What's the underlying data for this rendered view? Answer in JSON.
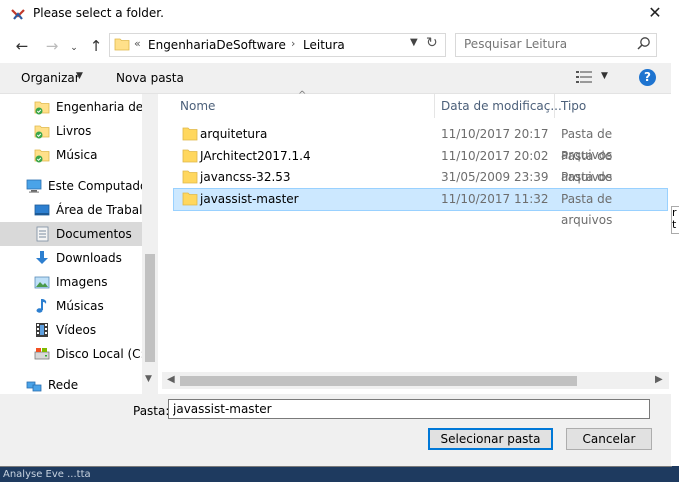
{
  "window": {
    "title": "Please select a folder."
  },
  "address": {
    "prefix": "«",
    "crumbs": [
      "EngenhariaDeSoftware",
      "Leitura"
    ],
    "separator": "›"
  },
  "search": {
    "placeholder": "Pesquisar Leitura"
  },
  "toolbar": {
    "organize_label": "Organizar",
    "new_folder_label": "Nova pasta"
  },
  "nav": {
    "items": [
      {
        "label": "Engenharia de Software",
        "icon": "folder-synced-icon"
      },
      {
        "label": "Livros",
        "icon": "folder-synced-icon"
      },
      {
        "label": "Música",
        "icon": "folder-synced-icon"
      },
      {
        "label": "Este Computador",
        "icon": "computer-icon"
      },
      {
        "label": "Área de Trabalho",
        "icon": "desktop-icon"
      },
      {
        "label": "Documentos",
        "icon": "documents-icon"
      },
      {
        "label": "Downloads",
        "icon": "downloads-icon"
      },
      {
        "label": "Imagens",
        "icon": "pictures-icon"
      },
      {
        "label": "Músicas",
        "icon": "music-icon"
      },
      {
        "label": "Vídeos",
        "icon": "videos-icon"
      },
      {
        "label": "Disco Local (C:)",
        "icon": "drive-icon"
      },
      {
        "label": "Rede",
        "icon": "network-icon"
      }
    ],
    "selected": "Documentos"
  },
  "columns": {
    "name": "Nome",
    "date": "Data de modificaç...",
    "type": "Tipo"
  },
  "files": [
    {
      "name": "arquitetura",
      "date": "11/10/2017 20:17",
      "type": "Pasta de arquivos"
    },
    {
      "name": "JArchitect2017.1.4",
      "date": "11/10/2017 20:02",
      "type": "Pasta de arquivos"
    },
    {
      "name": "javancss-32.53",
      "date": "31/05/2009 23:39",
      "type": "Pasta de arquivos"
    },
    {
      "name": "javassist-master",
      "date": "11/10/2017 11:32",
      "type": "Pasta de arquivos"
    }
  ],
  "selected_file": "javassist-master",
  "folder_field": {
    "label": "Pasta:",
    "value": "javassist-master"
  },
  "buttons": {
    "select": "Selecionar pasta",
    "cancel": "Cancelar"
  },
  "colors": {
    "selection": "#cce8ff",
    "selection_border": "#99d1ff",
    "nav_selected": "#d9d9d9",
    "help": "#1e74d0"
  },
  "background_app": {
    "edge_text": "r\nt",
    "taskbar_text": "Analyse Eve ...tta"
  }
}
